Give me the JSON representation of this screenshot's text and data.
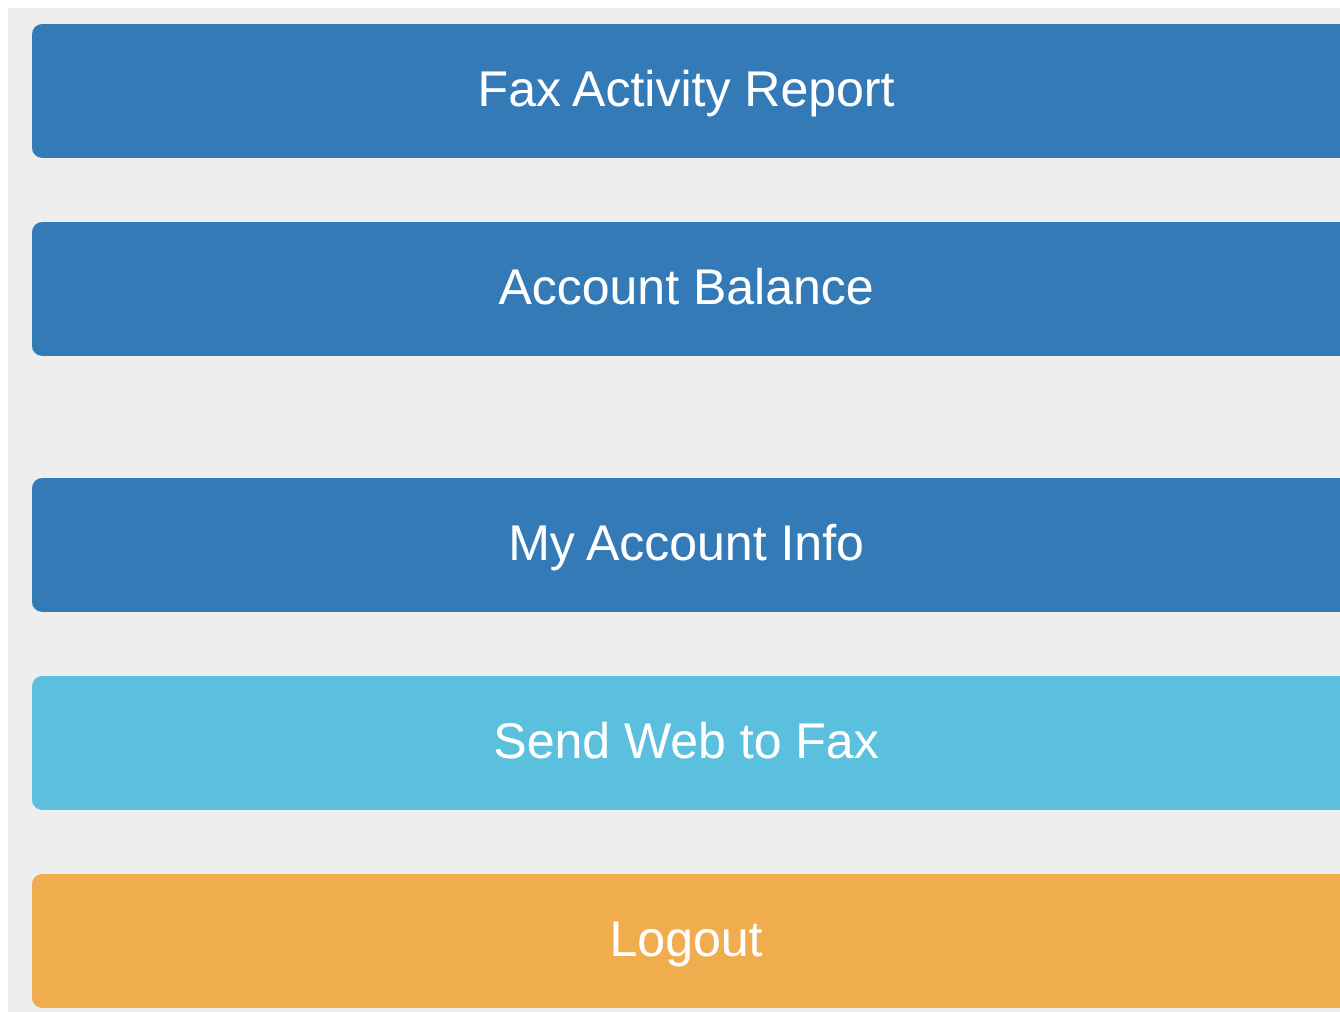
{
  "groups": [
    {
      "buttons": [
        {
          "label": "Fax Activity Report",
          "kind": "primary"
        },
        {
          "label": "Account Balance",
          "kind": "primary"
        }
      ]
    },
    {
      "buttons": [
        {
          "label": "My Account Info",
          "kind": "primary"
        },
        {
          "label": "Send Web to Fax",
          "kind": "info"
        },
        {
          "label": "Logout",
          "kind": "warning"
        }
      ]
    }
  ]
}
